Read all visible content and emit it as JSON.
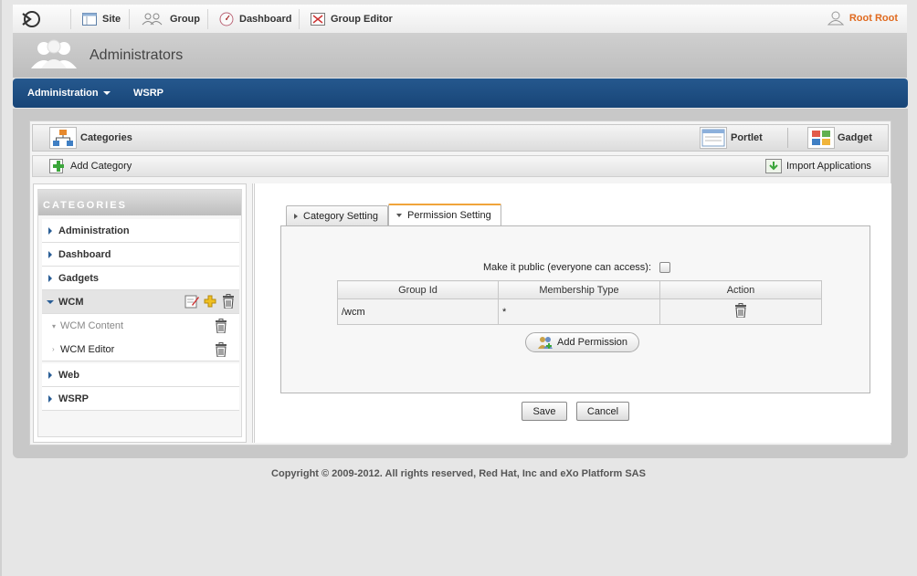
{
  "topbar": {
    "items": [
      {
        "label": "Site",
        "icon": "site-icon"
      },
      {
        "label": "Group",
        "icon": "group-icon"
      },
      {
        "label": "Dashboard",
        "icon": "dashboard-icon"
      },
      {
        "label": "Group Editor",
        "icon": "group-editor-icon"
      }
    ],
    "user": "Root Root"
  },
  "header": {
    "title": "Administrators"
  },
  "nav": {
    "items": [
      {
        "label": "Administration"
      },
      {
        "label": "WSRP"
      }
    ]
  },
  "portlet": {
    "categories_label": "Categories",
    "portlet_label": "Portlet",
    "gadget_label": "Gadget",
    "add_category": "Add Category",
    "import_applications": "Import Applications"
  },
  "categories": {
    "heading": "CATEGORIES",
    "items": [
      "Administration",
      "Dashboard",
      "Gadgets",
      "WCM",
      "Web",
      "WSRP"
    ],
    "wcm_children": [
      "WCM Content",
      "WCM Editor"
    ]
  },
  "settings": {
    "tab_category": "Category Setting",
    "tab_permission": "Permission Setting",
    "public_label": "Make it public (everyone can access):",
    "columns": [
      "Group Id",
      "Membership Type",
      "Action"
    ],
    "rows": [
      {
        "group_id": "/wcm",
        "membership": "*"
      }
    ],
    "add_permission": "Add Permission",
    "save": "Save",
    "cancel": "Cancel"
  },
  "footer": {
    "copyright": "Copyright © 2009-2012. All rights reserved, Red Hat, Inc and eXo Platform SAS"
  },
  "colors": {
    "nav_bg": "#1f4f84",
    "user_accent": "#e06a1f",
    "tab_accent": "#f0a43a"
  }
}
